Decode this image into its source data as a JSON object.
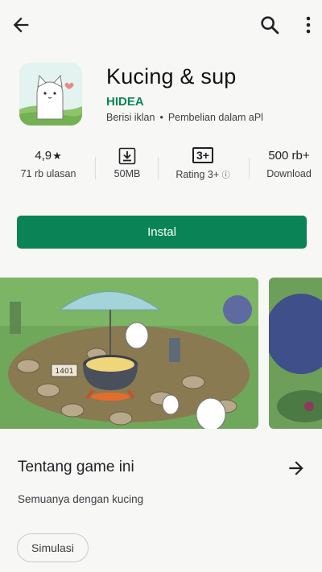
{
  "topbar": {
    "back_icon": "arrow-left-icon",
    "search_icon": "search-icon",
    "more_icon": "more-vert-icon"
  },
  "app": {
    "title": "Kucing & sup",
    "developer": "HIDEA",
    "ads": "Berisi iklan",
    "separator": "•",
    "iap": "Pembelian dalam aPl"
  },
  "stats": {
    "rating": {
      "value": "4,9",
      "star": "★",
      "label": "71 rb ulasan"
    },
    "size": {
      "icon": "download-box-icon",
      "label": "50MB"
    },
    "content_rating": {
      "badge": "3+",
      "label": "Rating 3+",
      "info": "ⓘ"
    },
    "downloads": {
      "value": "500 rb+",
      "label": "Download"
    }
  },
  "install": {
    "label": "Instal"
  },
  "screenshots": {
    "sign": "1401"
  },
  "about": {
    "title": "Tentang game ini",
    "description": "Semuanya dengan kucing",
    "tag": "Simulasi"
  },
  "colors": {
    "accent": "#0a8456",
    "developer": "#0b8457",
    "background": "#f7f7f5"
  }
}
